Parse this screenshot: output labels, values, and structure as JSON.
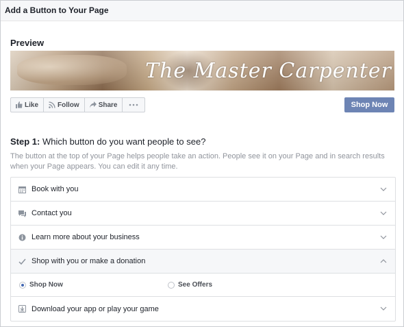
{
  "dialog": {
    "title": "Add a Button to Your Page"
  },
  "preview": {
    "heading": "Preview",
    "cover_logo_text": "The Master Carpenter",
    "actions": [
      {
        "label": "Like",
        "icon": "thumbs-up-icon"
      },
      {
        "label": "Follow",
        "icon": "rss-icon"
      },
      {
        "label": "Share",
        "icon": "share-arrow-icon"
      },
      {
        "label": "",
        "icon": "more-dots-icon"
      }
    ],
    "cta_button": "Shop Now",
    "cta_color": "#6d84b4"
  },
  "step1": {
    "label": "Step 1:",
    "question": " Which button do you want people to see?",
    "description": "The button at the top of your Page helps people take an action. People see it on your Page and in search results when your Page appears. You can edit it any time."
  },
  "options": [
    {
      "label": "Book with you",
      "icon": "calendar-icon",
      "expanded": false
    },
    {
      "label": "Contact you",
      "icon": "chat-icon",
      "expanded": false
    },
    {
      "label": "Learn more about your business",
      "icon": "info-icon",
      "expanded": false
    },
    {
      "label": "Shop with you or make a donation",
      "icon": "checkmark-icon",
      "expanded": true,
      "choices": [
        {
          "label": "Shop Now",
          "selected": true
        },
        {
          "label": "See Offers",
          "selected": false
        }
      ]
    },
    {
      "label": "Download your app or play your game",
      "icon": "download-icon",
      "expanded": false
    }
  ]
}
